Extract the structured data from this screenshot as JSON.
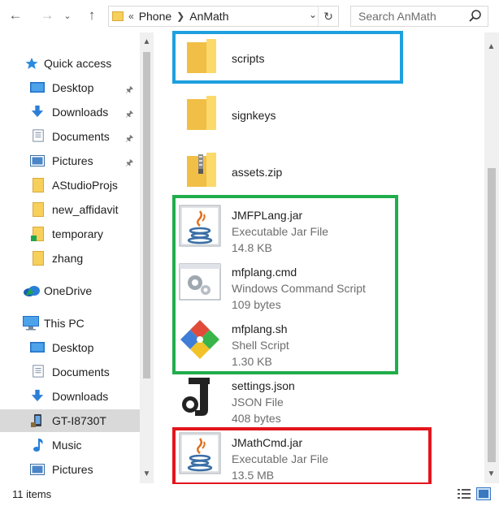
{
  "window": {
    "address": {
      "overflow": "«",
      "crumbs": [
        "Phone",
        "AnMath"
      ]
    },
    "search_placeholder": "Search AnMath"
  },
  "sidebar": {
    "items": [
      {
        "label": "Quick access",
        "icon": "star-icon",
        "pinned": false
      },
      {
        "label": "Desktop",
        "icon": "desktop-icon",
        "pinned": true
      },
      {
        "label": "Downloads",
        "icon": "download-arrow-icon",
        "pinned": true
      },
      {
        "label": "Documents",
        "icon": "document-icon",
        "pinned": true
      },
      {
        "label": "Pictures",
        "icon": "pictures-icon",
        "pinned": true
      },
      {
        "label": "AStudioProjs",
        "icon": "folder-icon",
        "pinned": false
      },
      {
        "label": "new_affidavit",
        "icon": "folder-icon",
        "pinned": false
      },
      {
        "label": "temporary",
        "icon": "folder-icon",
        "pinned": false
      },
      {
        "label": "zhang",
        "icon": "folder-icon",
        "pinned": false
      },
      {
        "label": "OneDrive",
        "icon": "cloud-icon",
        "pinned": false
      },
      {
        "label": "This PC",
        "icon": "computer-icon",
        "pinned": false
      },
      {
        "label": "Desktop",
        "icon": "desktop-icon",
        "pinned": false
      },
      {
        "label": "Documents",
        "icon": "document-icon",
        "pinned": false
      },
      {
        "label": "Downloads",
        "icon": "download-arrow-icon",
        "pinned": false
      },
      {
        "label": "GT-I8730T",
        "icon": "phone-icon",
        "pinned": false,
        "selected": true
      },
      {
        "label": "Music",
        "icon": "music-note-icon",
        "pinned": false
      },
      {
        "label": "Pictures",
        "icon": "pictures-icon",
        "pinned": false
      }
    ]
  },
  "files": [
    {
      "name": "scripts",
      "type": "",
      "size": "",
      "icon": "folder-icon"
    },
    {
      "name": "signkeys",
      "type": "",
      "size": "",
      "icon": "folder-icon"
    },
    {
      "name": "assets.zip",
      "type": "",
      "size": "",
      "icon": "zip-folder-icon"
    },
    {
      "name": "JMFPLang.jar",
      "type": "Executable Jar File",
      "size": "14.8 KB",
      "icon": "java-icon"
    },
    {
      "name": "mfplang.cmd",
      "type": "Windows Command Script",
      "size": "109 bytes",
      "icon": "cmd-script-icon"
    },
    {
      "name": "mfplang.sh",
      "type": "Shell Script",
      "size": "1.30 KB",
      "icon": "git-shell-icon"
    },
    {
      "name": "settings.json",
      "type": "JSON File",
      "size": "408 bytes",
      "icon": "json-icon"
    },
    {
      "name": "JMathCmd.jar",
      "type": "Executable Jar File",
      "size": "13.5 MB",
      "icon": "java-icon"
    }
  ],
  "status": {
    "item_count": "11 items"
  },
  "colors": {
    "highlight_blue": "#1ea0de",
    "highlight_green": "#21ad4b",
    "highlight_red": "#e3151d",
    "folder": "#f7cf5b"
  }
}
